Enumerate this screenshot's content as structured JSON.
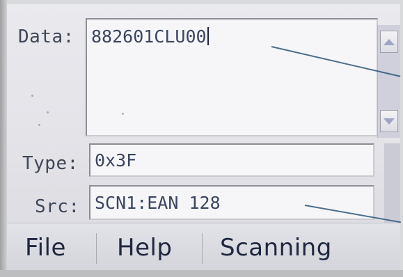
{
  "fields": {
    "data": {
      "label": "Data:",
      "value": "882601CLU00"
    },
    "type": {
      "label": "Type:",
      "value": "0x3F"
    },
    "src": {
      "label": "Src:",
      "value": "SCN1:EAN 128"
    }
  },
  "menu": {
    "items": [
      {
        "label": "File"
      },
      {
        "label": "Help"
      },
      {
        "label": "Scanning"
      }
    ]
  },
  "colors": {
    "screen_bg": "#e6e6eb",
    "text": "#3a4560",
    "menu_text": "#1f2740",
    "scroll_arrow": "#9fa5c4"
  },
  "icons": {
    "scroll_up": "triangle-up",
    "scroll_down": "triangle-down"
  }
}
